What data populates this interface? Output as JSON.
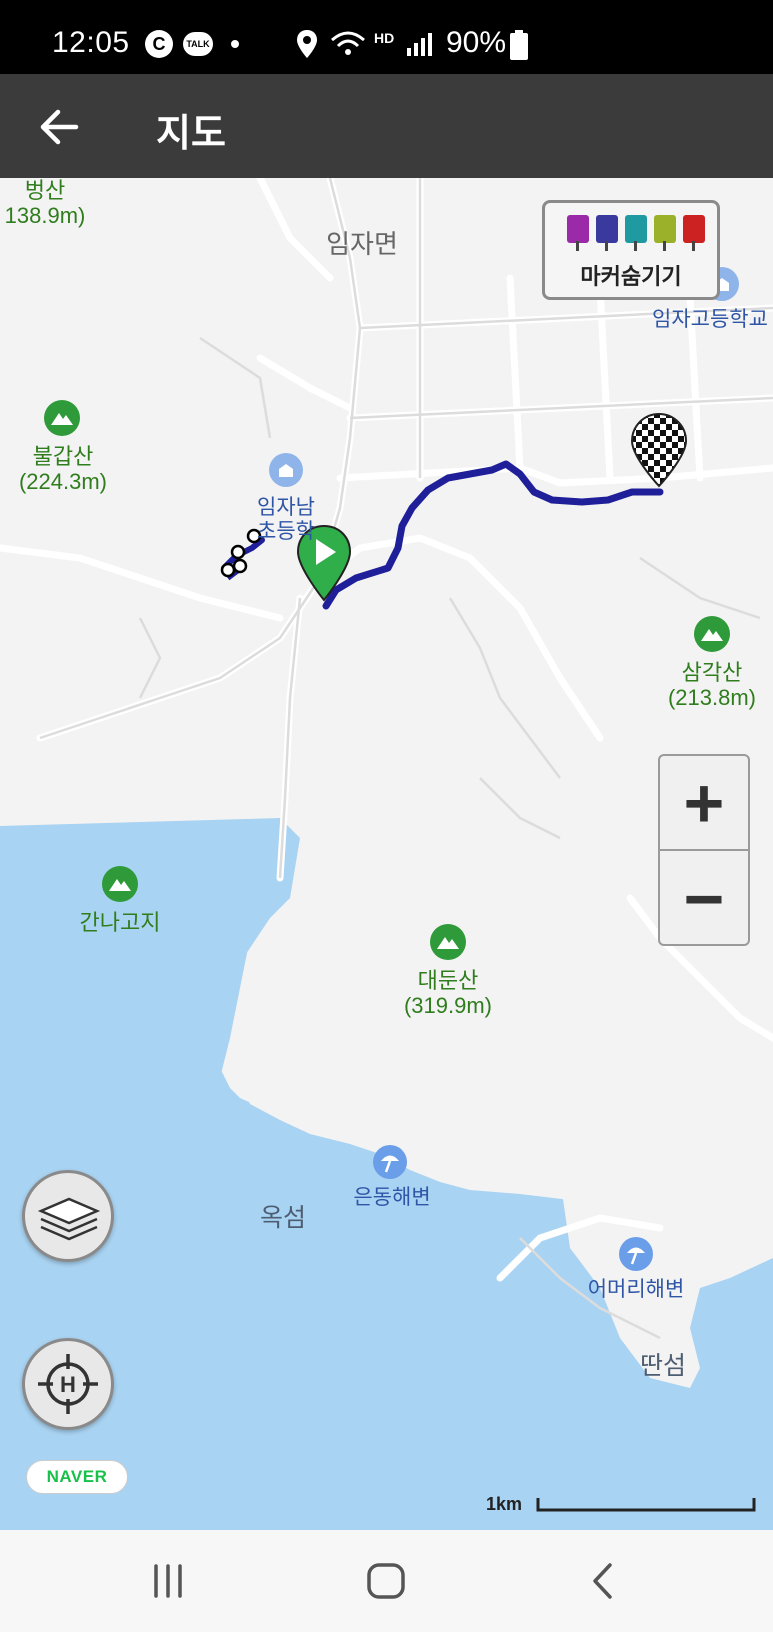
{
  "status_bar": {
    "time": "12:05",
    "battery": "90%",
    "c_badge": "C",
    "talk_badge": "TALK",
    "hd_badge": "HD"
  },
  "app_bar": {
    "title": "지도",
    "back_icon": "arrow-left-icon"
  },
  "marker_toggle": {
    "label": "마커숨기기",
    "pins": [
      {
        "icon": "camera-icon",
        "color": "#9a2aa8"
      },
      {
        "icon": "video-icon",
        "color": "#3a3a9e"
      },
      {
        "icon": "microphone-icon",
        "color": "#1f9aa0"
      },
      {
        "icon": "memo-icon",
        "color": "#9bb12a"
      },
      {
        "icon": "flag-icon",
        "color": "#cc2222"
      }
    ]
  },
  "map_labels": {
    "peaks": [
      {
        "name": "벙산",
        "height": "138.9m)"
      },
      {
        "name": "불갑산",
        "height": "(224.3m)"
      },
      {
        "name": "삼각산",
        "height": "(213.8m)"
      },
      {
        "name": "간나고지",
        "height": ""
      },
      {
        "name": "대둔산",
        "height": "(319.9m)"
      }
    ],
    "places": [
      "임자면"
    ],
    "pois": [
      "임자고등학교",
      "임자남",
      "초등학",
      "은동해변",
      "어머리해변"
    ],
    "islands": [
      "옥섬",
      "딴섬"
    ]
  },
  "zoom": {
    "in_label": "+",
    "out_label": "−"
  },
  "branding": {
    "naver": "NAVER"
  },
  "scale": {
    "label": "1km"
  },
  "colors": {
    "route": "#1f1f9a",
    "water": "#a9d3f2",
    "land": "#f3f3f3",
    "start_marker": "#2fae4a"
  }
}
